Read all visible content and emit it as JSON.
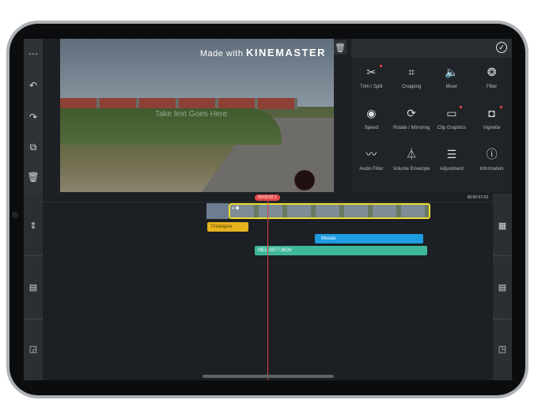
{
  "preview": {
    "watermark_prefix": "Made with",
    "watermark_brand": "KINEMASTER",
    "overlay_text": "Take text Goes Here"
  },
  "toolbar": {
    "more": "⋯",
    "undo": "↶",
    "redo": "↷",
    "capture": "⧉",
    "delete": "🗑"
  },
  "panel": {
    "confirm": "✓",
    "tools": [
      {
        "label": "Trim / Split",
        "icon": "✂",
        "dot": true
      },
      {
        "label": "Cropping",
        "icon": "⌗",
        "dot": false
      },
      {
        "label": "Mixer",
        "icon": "🔈",
        "dot": false
      },
      {
        "label": "Filter",
        "icon": "❂",
        "dot": false
      },
      {
        "label": "Speed",
        "icon": "◉",
        "dot": false
      },
      {
        "label": "Rotate / Mirroring",
        "icon": "⟳",
        "dot": false
      },
      {
        "label": "Clip Graphics",
        "icon": "▭",
        "dot": true
      },
      {
        "label": "Vignette",
        "icon": "◘",
        "dot": true
      },
      {
        "label": "Audio Filter",
        "icon": "〰",
        "dot": false
      },
      {
        "label": "Volume Envelope",
        "icon": "⏃",
        "dot": false
      },
      {
        "label": "Adjustment",
        "icon": "☰",
        "dot": false
      },
      {
        "label": "Information",
        "icon": "ⓘ",
        "dot": false
      }
    ]
  },
  "timeline": {
    "current_time": "00:00:02.1",
    "total_time": "00:00:07.63",
    "text_layer": "Timelapse",
    "mosaic_layer": "Mosaic",
    "audio_layer": "MEL-0077.MOV"
  },
  "colors": {
    "accent_yellow": "#f0dc2e",
    "playhead": "#e04040",
    "mosaic": "#1d9ce2",
    "audio": "#3fb79b",
    "text_layer": "#e6b31f"
  }
}
